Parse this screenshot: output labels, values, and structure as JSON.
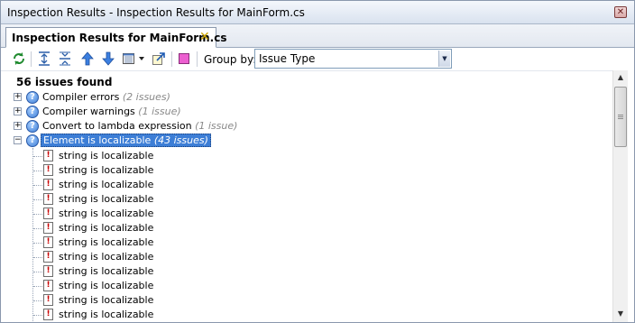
{
  "window": {
    "title": "Inspection Results - Inspection Results for MainForm.cs",
    "close_glyph": "✕"
  },
  "tab": {
    "label": "Inspection Results for MainForm.cs",
    "close_glyph": "✕"
  },
  "toolbar": {
    "group_by_label": "Group by:",
    "group_by_value": "Issue Type",
    "buttons": [
      "refresh-icon",
      "collapse-all-icon",
      "expand-all-icon",
      "previous-issue-icon",
      "next-issue-icon",
      "export-icon",
      "auto-scroll-icon",
      "filter-icon"
    ]
  },
  "summary": "56 issues found",
  "groups": [
    {
      "label": "Compiler errors",
      "count": "(2 issues)",
      "expanded": false,
      "selected": false
    },
    {
      "label": "Compiler warnings",
      "count": "(1 issue)",
      "expanded": false,
      "selected": false
    },
    {
      "label": "Convert to lambda expression",
      "count": "(1 issue)",
      "expanded": false,
      "selected": false
    },
    {
      "label": "Element is localizable",
      "count": "(43 issues)",
      "expanded": true,
      "selected": true
    }
  ],
  "issues": [
    "string is localizable",
    "string is localizable",
    "string is localizable",
    "string is localizable",
    "string is localizable",
    "string is localizable",
    "string is localizable",
    "string is localizable",
    "string is localizable",
    "string is localizable",
    "string is localizable",
    "string is localizable"
  ],
  "colors": {
    "selection": "#3d7ed6",
    "count_text": "#8a8a8a",
    "issue_icon": "#c80000",
    "group_icon": "#3d7dd6"
  }
}
